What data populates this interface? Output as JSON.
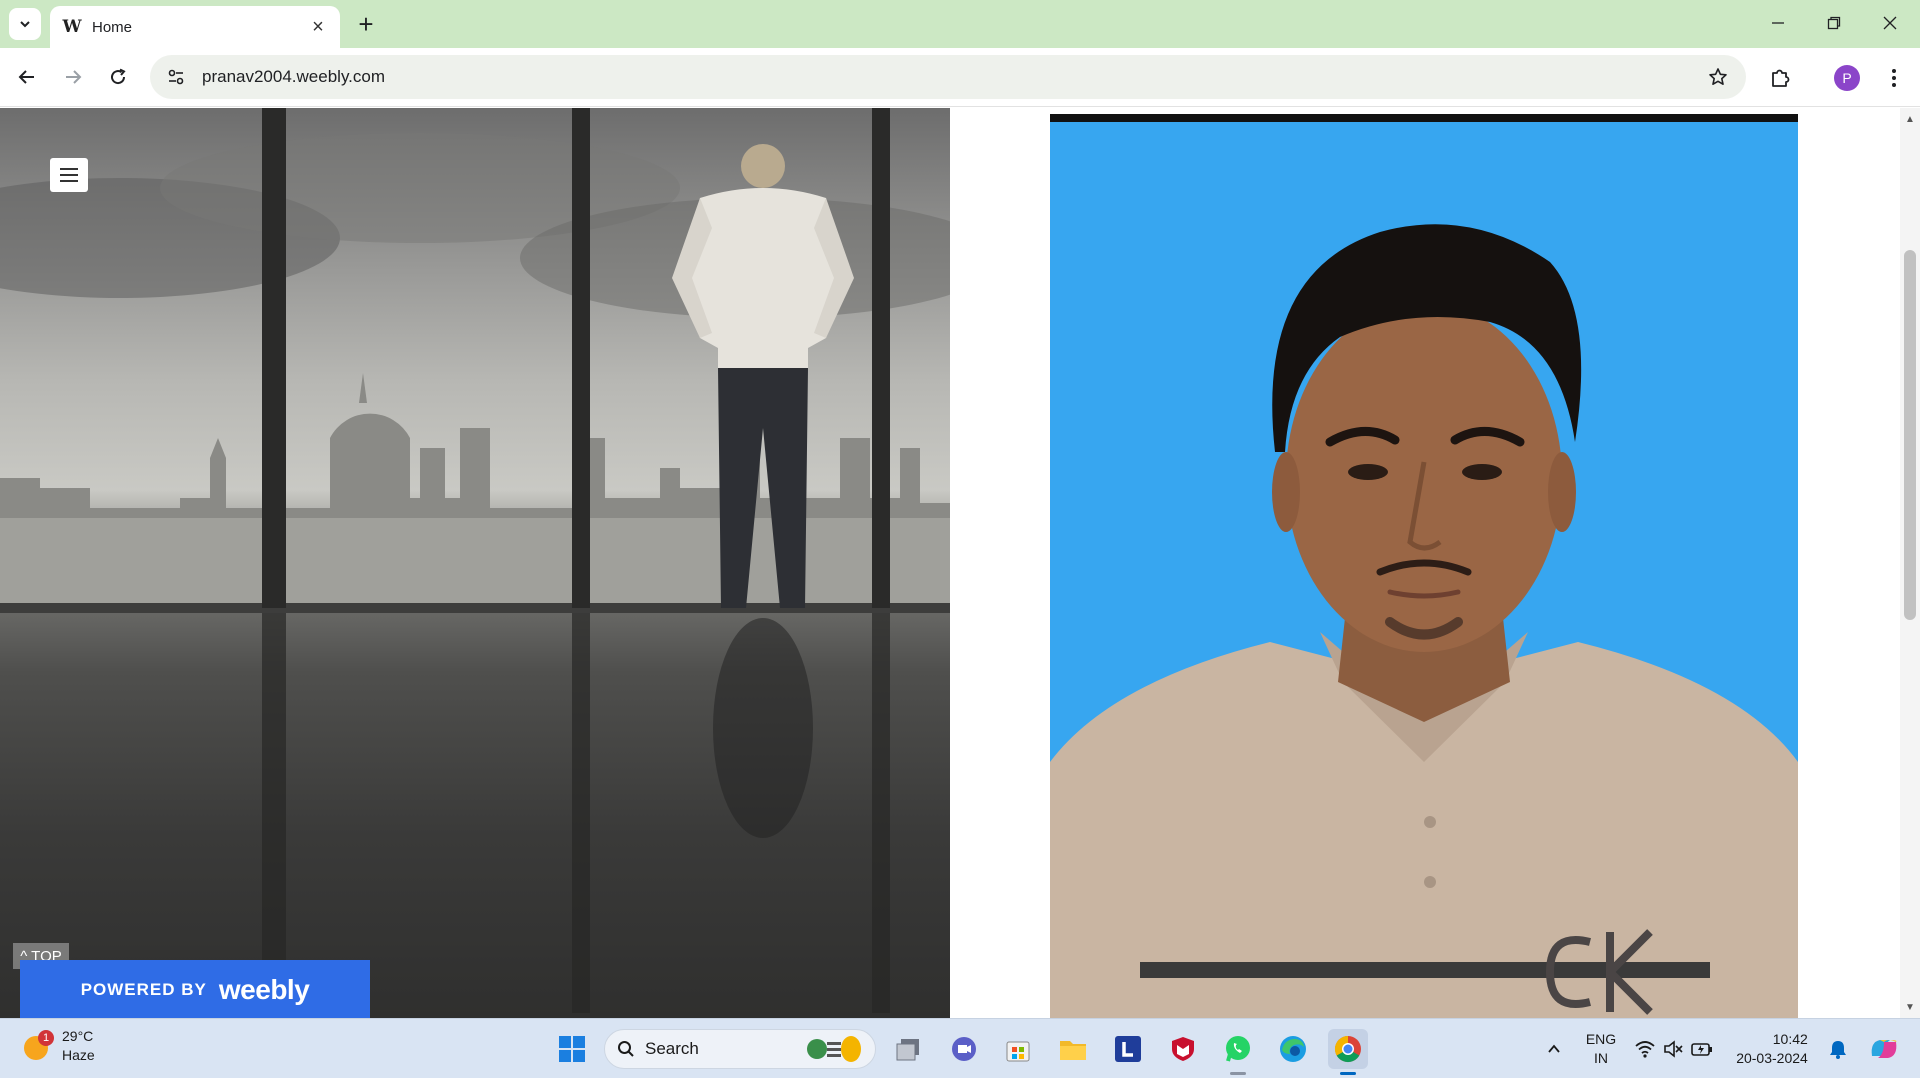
{
  "browser": {
    "tab": {
      "title": "Home"
    },
    "url": "pranav2004.weebly.com",
    "profile_initial": "P"
  },
  "page": {
    "top_link": "^ TOP",
    "footer_banner": {
      "powered_by": "POWERED BY",
      "brand": "weebly"
    }
  },
  "taskbar": {
    "weather": {
      "temp": "29°C",
      "condition": "Haze",
      "badge": "1"
    },
    "search_label": "Search",
    "language": {
      "line1": "ENG",
      "line2": "IN"
    },
    "clock": {
      "time": "10:42",
      "date": "20-03-2024"
    }
  },
  "colors": {
    "tabbar_bg": "#cce8c4",
    "weebly_blue": "#2f6ce6",
    "portrait_bg": "#37a6f0",
    "profile_purple": "#8b45c9"
  }
}
